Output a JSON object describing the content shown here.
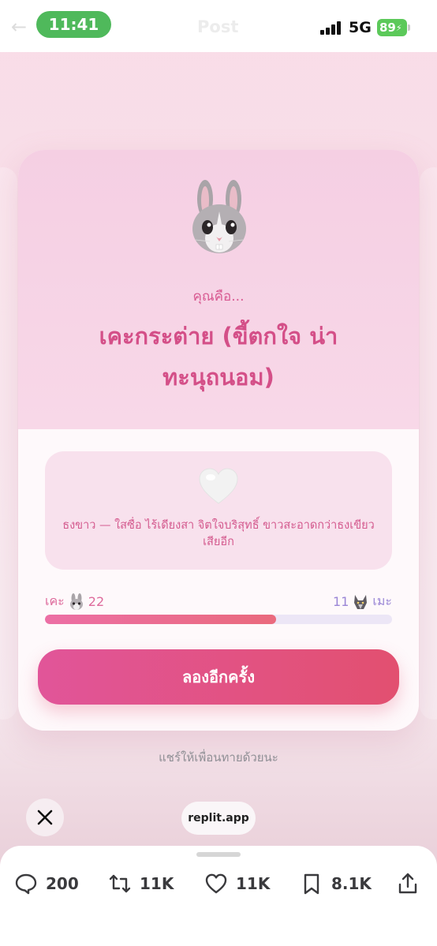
{
  "status_bar": {
    "time": "11:41",
    "network": "5G",
    "battery": "89",
    "ghost_title": "Post"
  },
  "card": {
    "emoji_icon": "rabbit-face-icon",
    "you_are": "คุณคือ...",
    "result_title": "เคะกระต่าย (ขี้ตกใจ น่าทะนุถนอม)",
    "heart_icon": "white-heart-icon",
    "description": "ธงขาว — ใสซื่อ ไร้เดียงสา จิตใจบริสุทธิ์ ขาวสะอาดกว่าธงเขียวเสียอีก",
    "score_left_label": "เคะ",
    "score_left_value": "22",
    "score_right_value": "11",
    "score_right_label": "เมะ",
    "progress_fraction": 0.667,
    "retry_label": "ลองอีกครั้ง"
  },
  "share_text": "แชร์ให้เพื่อนทายด้วยนะ",
  "browser": {
    "url": "replit.app"
  },
  "actions": {
    "replies": "200",
    "reposts": "11K",
    "likes": "11K",
    "bookmarks": "8.1K"
  },
  "colors": {
    "accent_pink": "#d44f88",
    "button_gradient_start": "#e15599",
    "button_gradient_end": "#e25070",
    "me_purple": "#9a86d6"
  }
}
